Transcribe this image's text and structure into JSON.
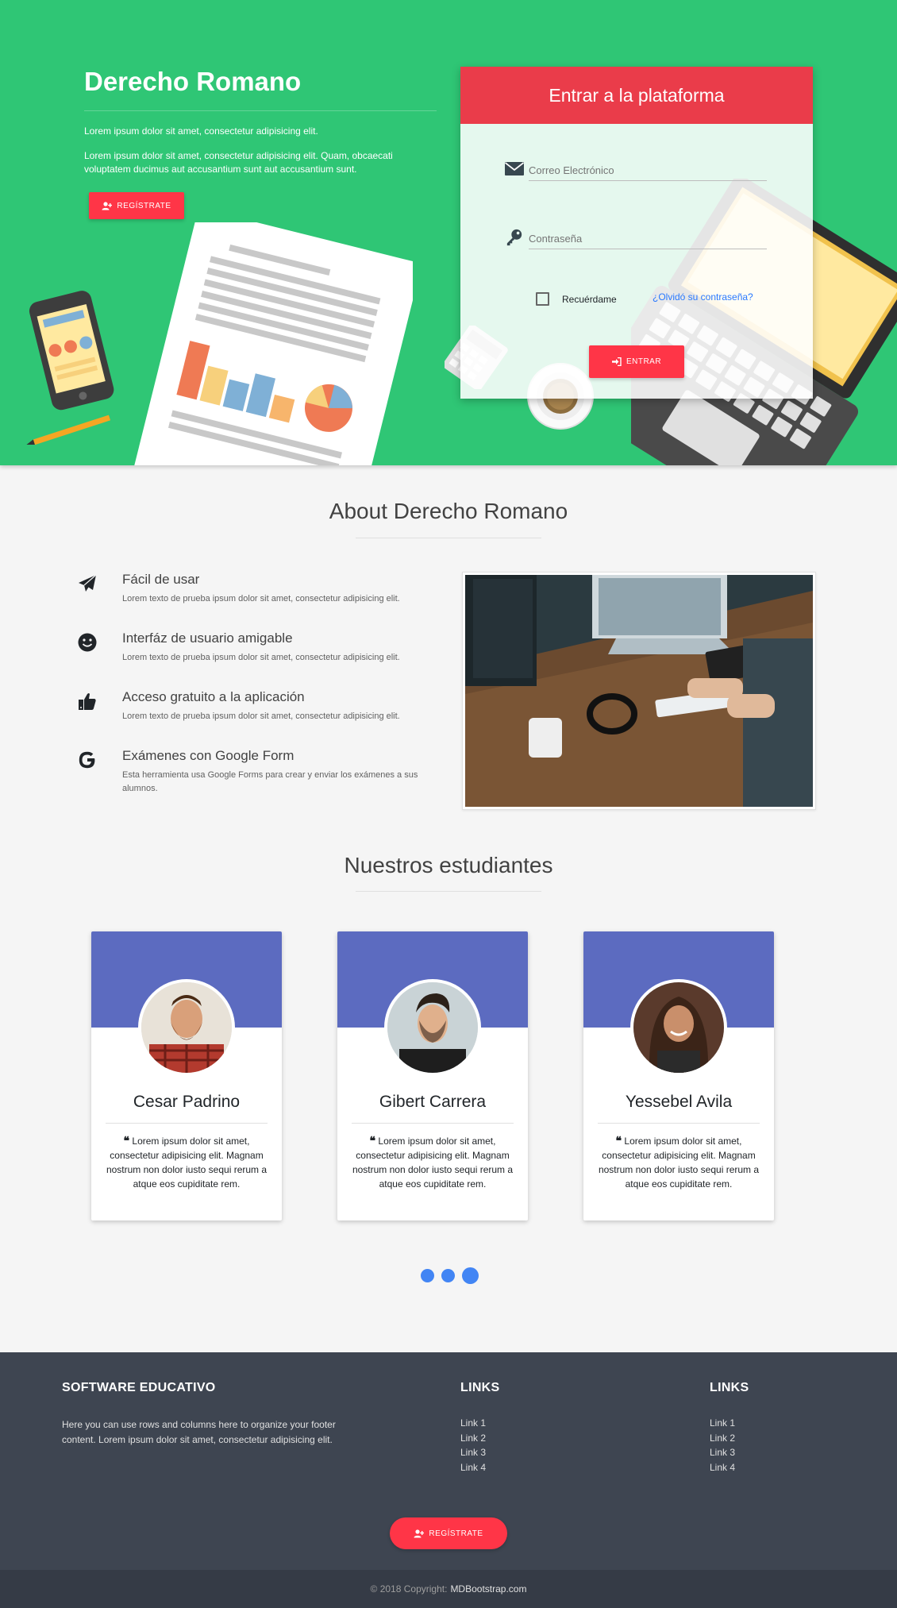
{
  "hero": {
    "title": "Derecho Romano",
    "paragraph1": "Lorem ipsum dolor sit amet, consectetur adipisicing elit.",
    "paragraph2": "Lorem ipsum dolor sit amet, consectetur adipisicing elit. Quam, obcaecati voluptatem ducimus aut accusantium sunt aut accusantium sunt.",
    "register_button": "REGÍSTRATE",
    "bg_color": "#2fc675"
  },
  "login": {
    "title": "Entrar a la plataforma",
    "email_placeholder": "Correo Electrónico",
    "password_placeholder": "Contraseña",
    "remember_label": "Recuérdame",
    "forgot_link": "¿Olvidó su contraseña?",
    "submit_button": "ENTRAR",
    "header_color": "#ea3c4a"
  },
  "about": {
    "title": "About Derecho Romano",
    "features": [
      {
        "icon": "paper-plane-icon",
        "title": "Fácil de usar",
        "description": "Lorem texto de prueba ipsum dolor sit amet, consectetur adipisicing elit."
      },
      {
        "icon": "smile-icon",
        "title": "Interfáz de usuario amigable",
        "description": "Lorem texto de prueba ipsum dolor sit amet, consectetur adipisicing elit."
      },
      {
        "icon": "thumbs-up-icon",
        "title": "Acceso gratuito a la aplicación",
        "description": "Lorem texto de prueba ipsum dolor sit amet, consectetur adipisicing elit."
      },
      {
        "icon": "google-icon",
        "title": "Exámenes con Google Form",
        "description": "Esta herramienta usa Google Forms para crear y enviar los exámenes a sus alumnos."
      }
    ]
  },
  "students": {
    "title": "Nuestros estudiantes",
    "cards": [
      {
        "name": "Cesar Padrino",
        "quote": "Lorem ipsum dolor sit amet, consectetur adipisicing elit. Magnam nostrum non dolor iusto sequi rerum a atque eos cupiditate rem."
      },
      {
        "name": "Gibert Carrera",
        "quote": "Lorem ipsum dolor sit amet, consectetur adipisicing elit. Magnam nostrum non dolor iusto sequi rerum a atque eos cupiditate rem."
      },
      {
        "name": "Yessebel Avila",
        "quote": "Lorem ipsum dolor sit amet, consectetur adipisicing elit. Magnam nostrum non dolor iusto sequi rerum a atque eos cupiditate rem."
      }
    ],
    "card_header_color": "#5c6bc0",
    "carousel_active_index": 2
  },
  "footer": {
    "brand_title": "SOFTWARE EDUCATIVO",
    "brand_text": "Here you can use rows and columns here to organize your footer content. Lorem ipsum dolor sit amet, consectetur adipisicing elit.",
    "links_title_1": "LINKS",
    "links_1": [
      "Link 1",
      "Link 2",
      "Link 3",
      "Link 4"
    ],
    "links_title_2": "LINKS",
    "links_2": [
      "Link 1",
      "Link 2",
      "Link 3",
      "Link 4"
    ],
    "register_button": "REGÍSTRATE",
    "copyright_text": "© 2018 Copyright:",
    "copyright_link": "MDBootstrap.com",
    "bg_color": "#3e4551"
  }
}
